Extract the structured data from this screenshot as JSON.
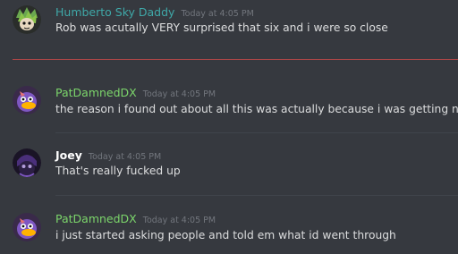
{
  "colors": {
    "background": "#36393f",
    "username_teal": "#43b581",
    "username_teal_light": "#3fa8a8",
    "username_green": "#7cd66b",
    "username_joey": "#ffffff",
    "timestamp": "#72767d",
    "text": "#dcddde",
    "new_messages_line": "#d64b4b"
  },
  "messages": [
    {
      "username": "Humberto Sky Daddy",
      "timestamp": "Today at 4:05 PM",
      "content": "Rob was acutally VERY surprised that six and i were so close",
      "avatar": "green-haired-character-avatar"
    },
    {
      "username": "PatDamnedDX",
      "timestamp": "Today at 4:05 PM",
      "content": "the reason i found out about all this was actually because i was getting nosey",
      "avatar": "purple-duck-character-avatar"
    },
    {
      "username": "Joey",
      "timestamp": "Today at 4:05 PM",
      "content": "That's really fucked up",
      "avatar": "dark-purple-character-avatar"
    },
    {
      "username": "PatDamnedDX",
      "timestamp": "Today at 4:05 PM",
      "content": "i just started asking people and told em what id went through",
      "avatar": "purple-duck-character-avatar"
    }
  ]
}
